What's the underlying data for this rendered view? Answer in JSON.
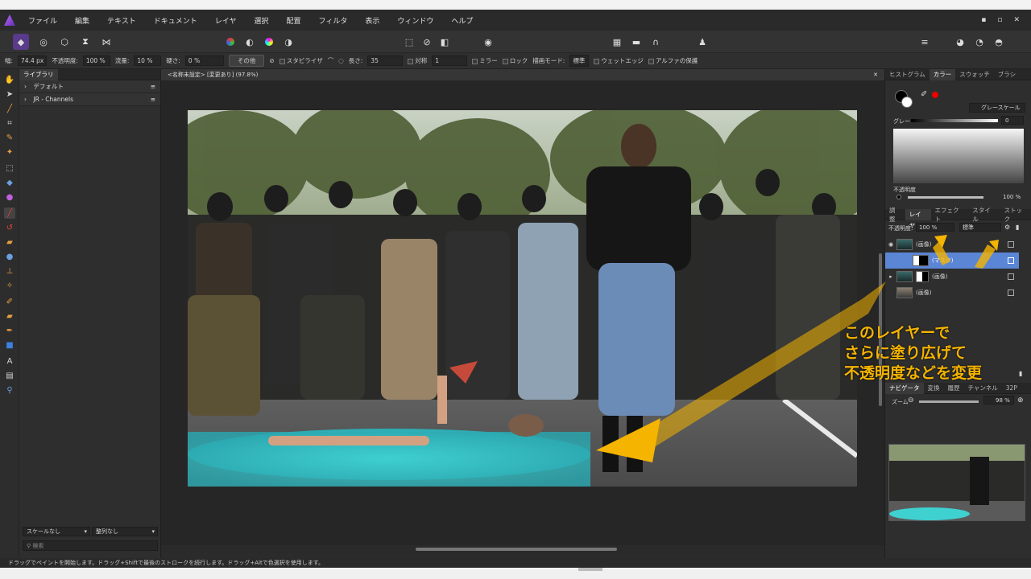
{
  "menu": {
    "items": [
      "ファイル",
      "編集",
      "テキスト",
      "ドキュメント",
      "レイヤ",
      "選択",
      "配置",
      "フィルタ",
      "表示",
      "ウィンドウ",
      "ヘルプ"
    ],
    "window_controls": [
      "▪",
      "▫",
      "✕"
    ]
  },
  "context_bar": {
    "width_label": "幅:",
    "width_value": "74.4 px",
    "opacity_label": "不透明度:",
    "opacity_value": "100 %",
    "flow_label": "流量:",
    "flow_value": "10 %",
    "hardness_label": "硬さ:",
    "hardness_value": "0 %",
    "more_button": "その他",
    "stabilizer_label": "スタビライザ",
    "length_label": "長さ:",
    "length_value": "35",
    "symmetry_label": "対称",
    "symmetry_value": "1",
    "mirror_label": "ミラー",
    "lock_label": "ロック",
    "blend_mode_label": "描画モード:",
    "blend_mode_value": "標準",
    "wet_edges_label": "ウェットエッジ",
    "protect_alpha_label": "アルファの保護"
  },
  "library_panel": {
    "tab": "ライブラリ",
    "items": [
      "デフォルト",
      "JR - Channels"
    ],
    "scale_select": "スケールなし",
    "sort_select": "整列なし",
    "search_placeholder": "検索"
  },
  "document": {
    "tab_title": "<名称未設定> [変更あり] (97.8%)"
  },
  "color_panel": {
    "tabs": [
      "ヒストグラム",
      "カラー",
      "スウォッチ",
      "ブラシ"
    ],
    "active_tab": "カラー",
    "mode_select": "グレースケール",
    "gray_label": "グレー",
    "gray_value": "0",
    "opacity_label": "不透明度",
    "opacity_value": "100 %"
  },
  "layers_panel": {
    "tabs": [
      "調整",
      "レイヤ",
      "エフェクト",
      "スタイル",
      "ストック"
    ],
    "active_tab": "レイヤ",
    "opacity_label": "不透明度:",
    "opacity_value": "100 %",
    "blend_value": "標準",
    "layers": [
      {
        "name": "(画像)",
        "selected": false
      },
      {
        "name": "(マスク)",
        "selected": true
      },
      {
        "name": "(画像)",
        "selected": false
      },
      {
        "name": "(画像)",
        "selected": false
      }
    ]
  },
  "navigator_panel": {
    "tabs": [
      "ナビゲータ",
      "変換",
      "履歴",
      "チャンネル",
      "32P"
    ],
    "active_tab": "ナビゲータ",
    "zoom_label": "ズーム",
    "zoom_value": "98 %"
  },
  "status_bar": {
    "text": "ドラッグでペイントを開始します。ドラッグ+Shiftで最後のストロークを続行します。ドラッグ+Altで色選択を使用します。"
  },
  "annotation": {
    "lines": [
      "このレイヤーで",
      "さらに塗り広げて",
      "不透明度などを変更"
    ],
    "color": "#f5b400"
  },
  "colors": {
    "accent": "#4a78c9",
    "selection": "#5b86d6"
  }
}
